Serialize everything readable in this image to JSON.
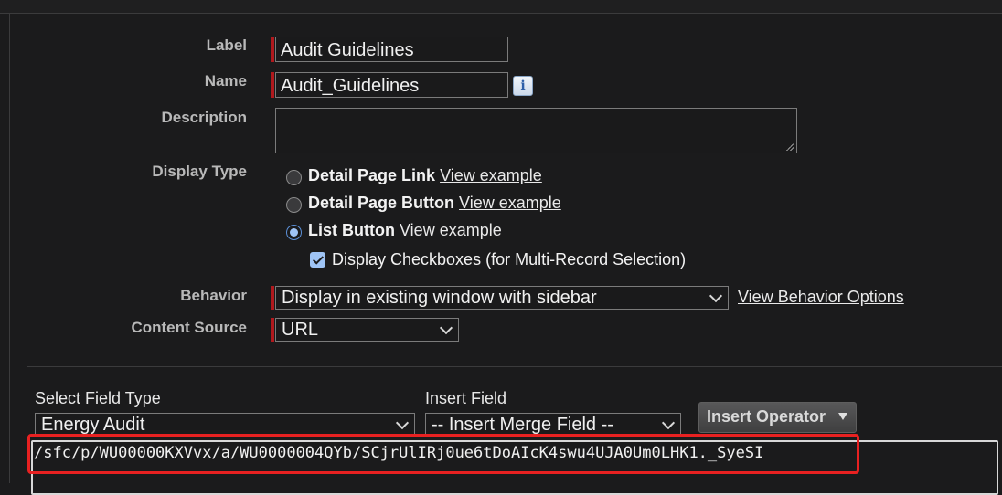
{
  "form": {
    "label": {
      "label": "Label",
      "value": "Audit Guidelines"
    },
    "name": {
      "label": "Name",
      "value": "Audit_Guidelines",
      "info_icon": "info-icon"
    },
    "description": {
      "label": "Description",
      "value": ""
    },
    "display_type": {
      "label": "Display Type",
      "options": [
        {
          "text": "Detail Page Link",
          "link": "View example",
          "selected": false
        },
        {
          "text": "Detail Page Button",
          "link": "View example",
          "selected": false
        },
        {
          "text": "List Button",
          "link": "View example",
          "selected": true
        }
      ],
      "checkbox_label": "Display Checkboxes (for Multi-Record Selection)",
      "checkbox_checked": true
    },
    "behavior": {
      "label": "Behavior",
      "value": "Display in existing window with sidebar",
      "link": "View Behavior Options"
    },
    "content_source": {
      "label": "Content Source",
      "value": "URL"
    }
  },
  "editor": {
    "select_field_type_label": "Select Field Type",
    "select_field_type_value": "Energy Audit",
    "insert_field_label": "Insert Field",
    "insert_field_value": "-- Insert Merge Field --",
    "insert_operator_label": "Insert Operator",
    "formula": "/sfc/p/WU00000KXVvx/a/WU0000004QYb/SCjrUlIRj0ue6tDoAIcK4swu4UJA0Um0LHK1._SyeSI"
  },
  "colors": {
    "required": "#b0191d",
    "highlight": "#e82121",
    "radio_selected": "#9fc4f5"
  }
}
